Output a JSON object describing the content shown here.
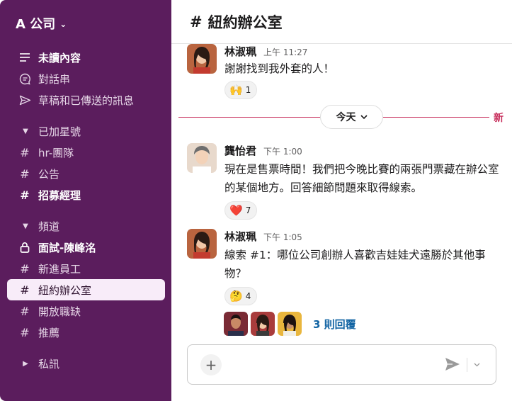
{
  "workspace": {
    "name": "A 公司"
  },
  "sidebar": {
    "top_items": [
      {
        "label": "未讀內容",
        "icon": "unread-list-icon"
      },
      {
        "label": "對話串",
        "icon": "threads-icon"
      },
      {
        "label": "草稿和已傳送的訊息",
        "icon": "send-icon"
      }
    ],
    "starred": {
      "label": "已加星號",
      "items": [
        "hr-團隊",
        "公告",
        "招募經理"
      ]
    },
    "channels": {
      "label": "頻道",
      "items": [
        "面試-陳峰洺",
        "新進員工",
        "紐約辦公室",
        "開放職缺",
        "推薦"
      ]
    },
    "dms": {
      "label": "私訊"
    }
  },
  "channel": {
    "name": "紐約辦公室",
    "hash": "#"
  },
  "divider": {
    "today": "今天",
    "new": "新"
  },
  "messages": [
    {
      "author": "林淑珮",
      "time": "上午 11:27",
      "text": "謝謝找到我外套的人！",
      "reaction_emoji": "🙌",
      "reaction_count": "1"
    },
    {
      "author": "龔怡君",
      "time": "下午 1:00",
      "text": "現在是售票時間！我們把今晚比賽的兩張門票藏在辦公室的某個地方。回答細節問題來取得線索。",
      "reaction_emoji": "❤️",
      "reaction_count": "7"
    },
    {
      "author": "林淑珮",
      "time": "下午 1:05",
      "text": "線索 #1：哪位公司創辦人喜歡吉娃娃犬遠勝於其他事物？",
      "reaction_emoji": "🤔",
      "reaction_count": "4"
    }
  ],
  "thread": {
    "replies": "3 則回覆"
  },
  "composer": {
    "placeholder": ""
  },
  "colors": {
    "sidebar": "#5b1d5d",
    "accent_new": "#c8315e",
    "link": "#1264a3"
  }
}
